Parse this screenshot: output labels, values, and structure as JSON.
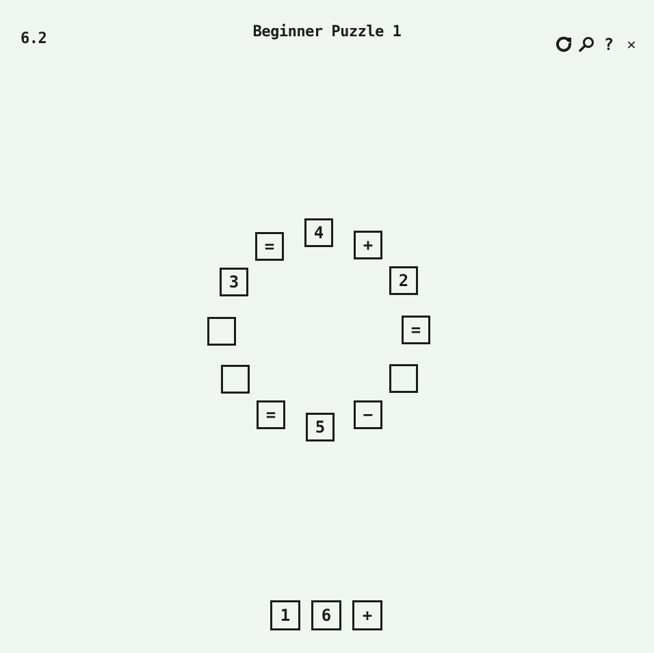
{
  "header": {
    "version": "6.2",
    "title": "Beginner Puzzle 1"
  },
  "toolbar": {
    "icons": [
      "restart-icon",
      "search-icon",
      "help-icon",
      "close-icon"
    ],
    "help_glyph": "?",
    "close_glyph": "✕"
  },
  "ring": {
    "tiles": [
      {
        "value": "4"
      },
      {
        "value": "+"
      },
      {
        "value": "2"
      },
      {
        "value": "="
      },
      {
        "value": ""
      },
      {
        "value": "−"
      },
      {
        "value": "5"
      },
      {
        "value": "="
      },
      {
        "value": ""
      },
      {
        "value": ""
      },
      {
        "value": "3"
      },
      {
        "value": "="
      }
    ]
  },
  "tray": {
    "tiles": [
      {
        "value": "1"
      },
      {
        "value": "6"
      },
      {
        "value": "+"
      }
    ]
  },
  "colors": {
    "background": "#eff6ef",
    "ink": "#1c1c1c"
  }
}
